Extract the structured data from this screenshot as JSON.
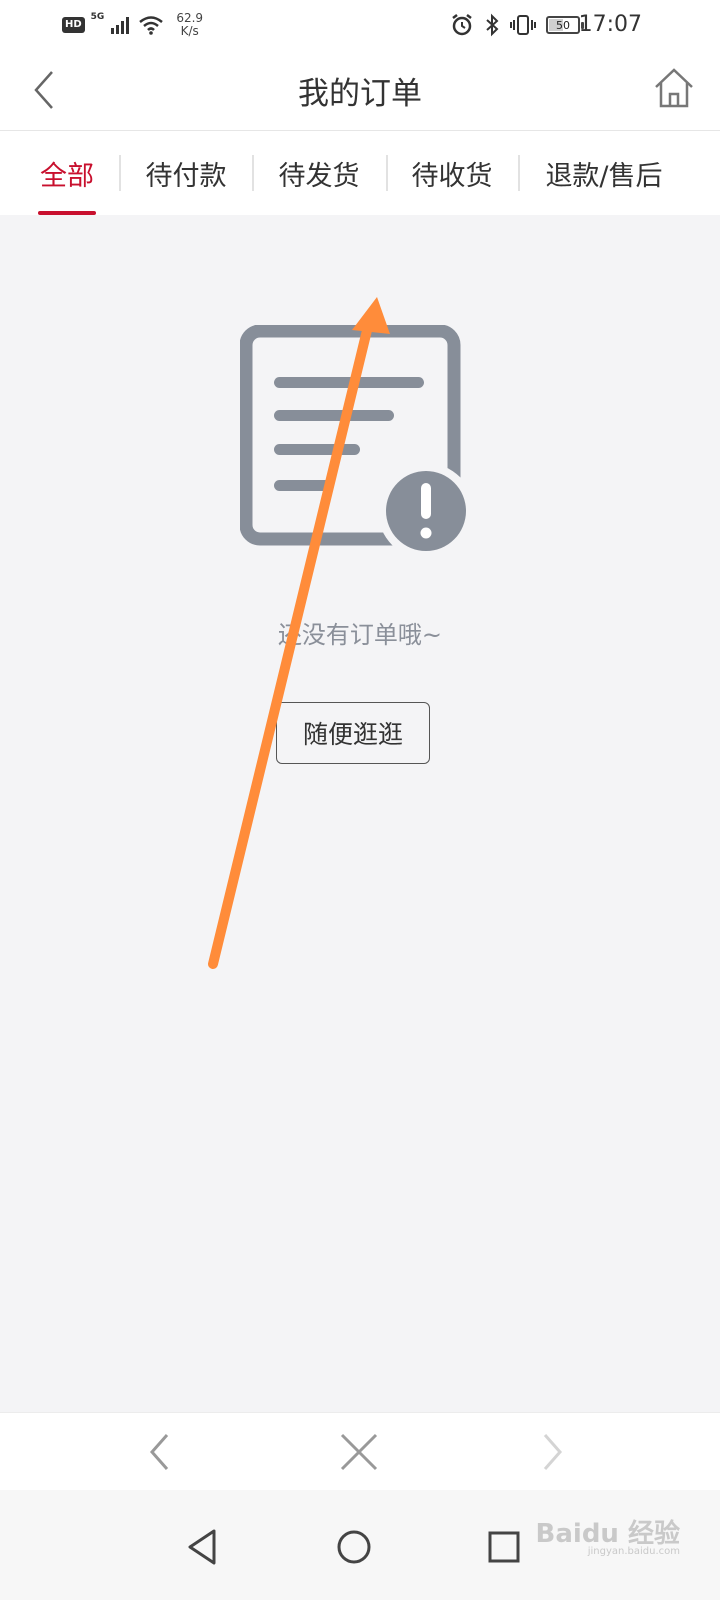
{
  "status_bar": {
    "hd_label": "HD",
    "network_label": "5G",
    "speed_value": "62.9",
    "speed_unit": "K/s",
    "battery_level": "50",
    "battery_fraction": 0.5,
    "time": "17:07",
    "icons": [
      "signal-icon",
      "wifi-icon",
      "alarm-icon",
      "bluetooth-icon",
      "vibrate-icon",
      "battery-icon"
    ]
  },
  "header": {
    "title": "我的订单",
    "back_icon": "chevron-left-icon",
    "home_icon": "home-icon"
  },
  "tabs": [
    {
      "label": "全部",
      "active": true
    },
    {
      "label": "待付款",
      "active": false
    },
    {
      "label": "待发货",
      "active": false
    },
    {
      "label": "待收货",
      "active": false
    },
    {
      "label": "退款/售后",
      "active": false
    }
  ],
  "empty_state": {
    "icon": "order-empty-icon",
    "message": "还没有订单哦~",
    "button_label": "随便逛逛"
  },
  "browser_bar": {
    "icons": [
      "back-icon",
      "close-icon",
      "forward-icon"
    ]
  },
  "system_nav": {
    "icons": [
      "nav-back-icon",
      "nav-home-icon",
      "nav-recents-icon"
    ],
    "watermark": "Baidu 经验",
    "watermark_sub": "jingyan.baidu.com"
  },
  "colors": {
    "accent": "#c8102e",
    "background": "#f4f4f6",
    "icon_gray": "#878e99",
    "annotation_arrow": "#ff8c3a"
  }
}
